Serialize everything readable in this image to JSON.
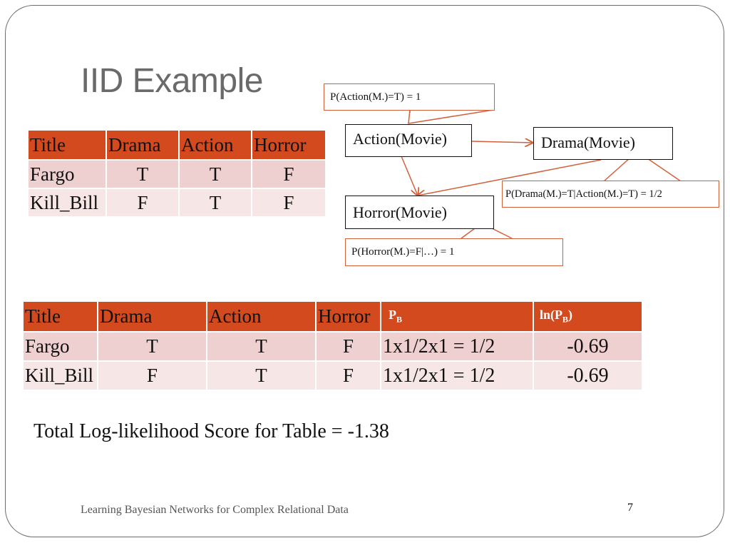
{
  "slide": {
    "title": "IID Example",
    "footer": "Learning Bayesian Networks for Complex Relational Data",
    "page_number": "7"
  },
  "table1": {
    "headers": [
      "Title",
      "Drama",
      "Action",
      "Horror"
    ],
    "rows": [
      [
        "Fargo",
        "T",
        "T",
        "F"
      ],
      [
        "Kill_Bill",
        "F",
        "T",
        "F"
      ]
    ]
  },
  "diagram": {
    "nodes": {
      "action": "Action(Movie)",
      "drama": "Drama(Movie)",
      "horror": "Horror(Movie)"
    },
    "callouts": {
      "action": "P(Action(M.)=T) = 1",
      "drama": "P(Drama(M.)=T|Action(M.)=T) = 1/2",
      "horror": "P(Horror(M.)=F|…) = 1"
    },
    "edges": [
      {
        "from": "Action(Movie)",
        "to": "Drama(Movie)"
      },
      {
        "from": "Action(Movie)",
        "to": "Horror(Movie)"
      },
      {
        "from": "Drama(Movie)",
        "to": "Horror(Movie)"
      }
    ],
    "colors": {
      "edge": "#d2603a",
      "callout_border": "#d2603a"
    }
  },
  "table2": {
    "headers": [
      "Title",
      "Drama",
      "Action",
      "Horror"
    ],
    "pb_header": {
      "main": "P",
      "sub": "B"
    },
    "lnpb_header": {
      "pre": "ln(P",
      "sub": "B",
      "post": ")"
    },
    "rows": [
      [
        "Fargo",
        "T",
        "T",
        "F",
        "1x1/2x1 = 1/2",
        "-0.69"
      ],
      [
        "Kill_Bill",
        "F",
        "T",
        "F",
        "1x1/2x1 = 1/2",
        "-0.69"
      ]
    ]
  },
  "total": "Total Log-likelihood Score for Table = -1.38",
  "colors": {
    "header_bg": "#d24a1e",
    "row_odd": "#efd0d0",
    "row_even": "#f6e6e6",
    "title": "#6a6a6a"
  }
}
